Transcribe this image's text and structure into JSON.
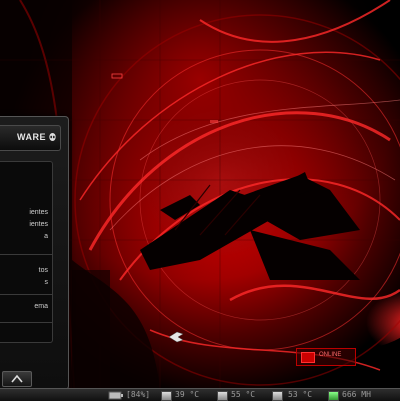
{
  "start_menu": {
    "brand": "WARE",
    "items": [
      {
        "label": "ientes"
      },
      {
        "label": "ientes"
      },
      {
        "label": "a"
      },
      {
        "label": "tos"
      },
      {
        "label": "s"
      },
      {
        "label": "ema"
      }
    ]
  },
  "widget": {
    "label": "ONLINE"
  },
  "taskbar": {
    "battery": "[84%]",
    "temps": [
      {
        "label": "39 °C"
      },
      {
        "label": "55 °C"
      },
      {
        "label": "53 °C"
      }
    ],
    "clock_speed": "666 MH"
  },
  "colors": {
    "accent": "#e00000",
    "panel": "#151515"
  }
}
